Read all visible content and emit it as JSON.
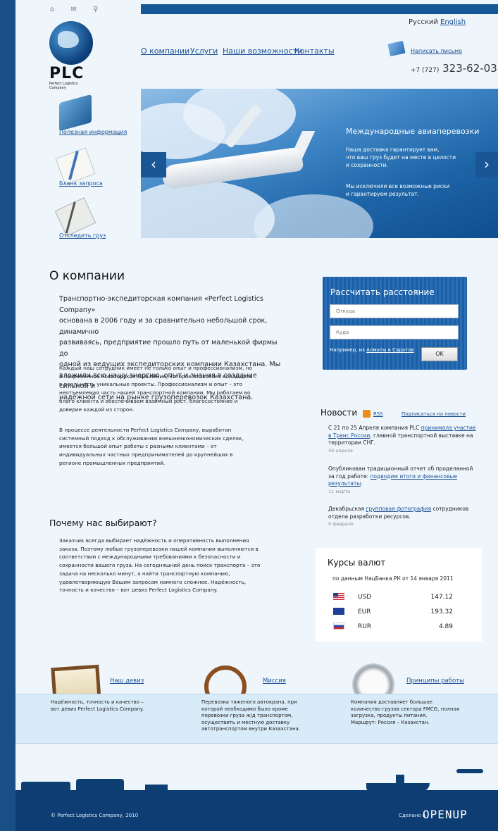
{
  "top_icons": "⌂ ✉ ⚲",
  "logo": {
    "text": "PLC",
    "subtitle": "Perfect Logistics Company"
  },
  "languages": {
    "ru": "Русский",
    "en": "English"
  },
  "nav": [
    "О компании",
    "Услуги",
    "Наши возможности",
    "Контакты"
  ],
  "contact": {
    "mail_link": "Написать письмо",
    "phone_prefix": "+7 (727)",
    "phone_number": "323-62-03"
  },
  "sidebar": [
    "Полезная информация",
    "Бланк запроса",
    "Отследить груз"
  ],
  "slider": {
    "title": "Международные авиаперевозки",
    "text1": [
      "Наша доставка гарантирует вам,",
      "что ваш груз будет на месте в целости",
      "и сохранности."
    ],
    "text2": [
      "Мы исключили все возможные риски",
      "и гарантируем результат."
    ],
    "prev": "‹",
    "next": "›"
  },
  "about": {
    "title": "О компании",
    "lead": [
      "Транспортно-экспедиторская компания «Perfect Logistics Company»",
      "основана в 2006 году и за сравнительно небольшой срок, динамично",
      "развиваясь, предприятие прошло путь от маленькой фирмы до",
      "одной из ведущих экспедиторских компании Казахстана. Мы",
      "вложили всю нашу энергию, опыт и знания в создание сильной и",
      "надёжной сети на рынке грузоперевозок Казахстана."
    ],
    "p2": [
      "Каждый наш сотрудник имеет не только опыт и профессионализм, но",
      "и современное новаторское мышление, которое позволяет воплощать",
      "в реальность уникальные проекты. Профессионализм и опыт – это",
      "неотъемлемая часть нашей транспортной компании. Мы работаем во",
      "благо клиента и обеспечиваем взаимный рост, благосостояние и",
      "доверие каждой из сторон."
    ],
    "p3": [
      "В процессе деятельности Perfect Logistics Company, выработан",
      "системный подход к обслуживанию внешнеэкономических сделок,",
      "имеется большой опыт работы с разными клиентами – от",
      "индивидуальных частных предпринимателей до крупнейших в",
      "регионе промышленных предприятий."
    ]
  },
  "why": {
    "title": "Почему нас выбирают?",
    "text": [
      "Заказчик всегда выбирает надёжность и оперативность выполнения",
      "заказа. Поэтому любые грузоперевозки нашей компании выполняются в",
      "соответствии с международными требованиями к безопасности и",
      "сохранности вашего груза. На сегодняшний день поиск транспорта – это",
      "задача на несколько минут, а найти транспортную компанию,",
      "удовлетворяющую Вашим запросам намного сложнее. Надёжность,",
      "точность и качество – вот девиз Perfect Logistics Company."
    ]
  },
  "calc": {
    "title": "Рассчитать расстояние",
    "from_placeholder": "Откуда",
    "to_placeholder": "Куда",
    "example_prefix": "Например, из",
    "example_link": "Алматы в Саратов",
    "ok": "OK"
  },
  "news": {
    "title": "Новости",
    "rss": "RSS",
    "subscribe": "Подписаться на новости",
    "items": [
      {
        "pre": "С 21 по 25 Апреля компания PLC ",
        "link": "принимала участие в Транс России",
        "post": ", главной транспортной выставке на территории СНГ.",
        "date": "30 апреля"
      },
      {
        "pre": "Опубликован традиционный отчет об проделанной за год работе: ",
        "link": "подводим итоги и финансовые результаты",
        "post": ".",
        "date": "11 марта"
      },
      {
        "pre": "Декабрьская ",
        "link": "групповая фотография",
        "post": " сотрудников отдела разработки ресурсов.",
        "date": "9 февраля"
      }
    ]
  },
  "rates": {
    "title": "Курсы валют",
    "subtitle": "по данным НацБанка РК от 14 января 2011",
    "items": [
      {
        "code": "USD",
        "value": "147.12",
        "flag": "us-flag"
      },
      {
        "code": "EUR",
        "value": "193.32",
        "flag": "eu-flag"
      },
      {
        "code": "RUR",
        "value": "4.89",
        "flag": "ru-flag"
      }
    ]
  },
  "cards": [
    {
      "title": "Наш девиз",
      "text": [
        "Надёжность, точность и качество –",
        "вот девиз Perfect Logistics Company."
      ]
    },
    {
      "title": "Миссия",
      "text": [
        "Перевозка тяжелого автокрана, при",
        "которой необходимо было кроме",
        "перевозки груза ж/д транспортом,",
        "осуществить и  местную доставку",
        "автотранспортом внутри Казахстана."
      ]
    },
    {
      "title": "Принципы работы",
      "text": [
        "Компания доставляет большое",
        "количество грузов сектора FMCG, полная",
        "загрузка, продукты питания.",
        "Маршрут: Россия – Казахстан."
      ]
    }
  ],
  "footer": {
    "copyright": "© Perfect Logistics Company, 2010",
    "made_in": "Сделано в",
    "openup": "OPENUP"
  }
}
